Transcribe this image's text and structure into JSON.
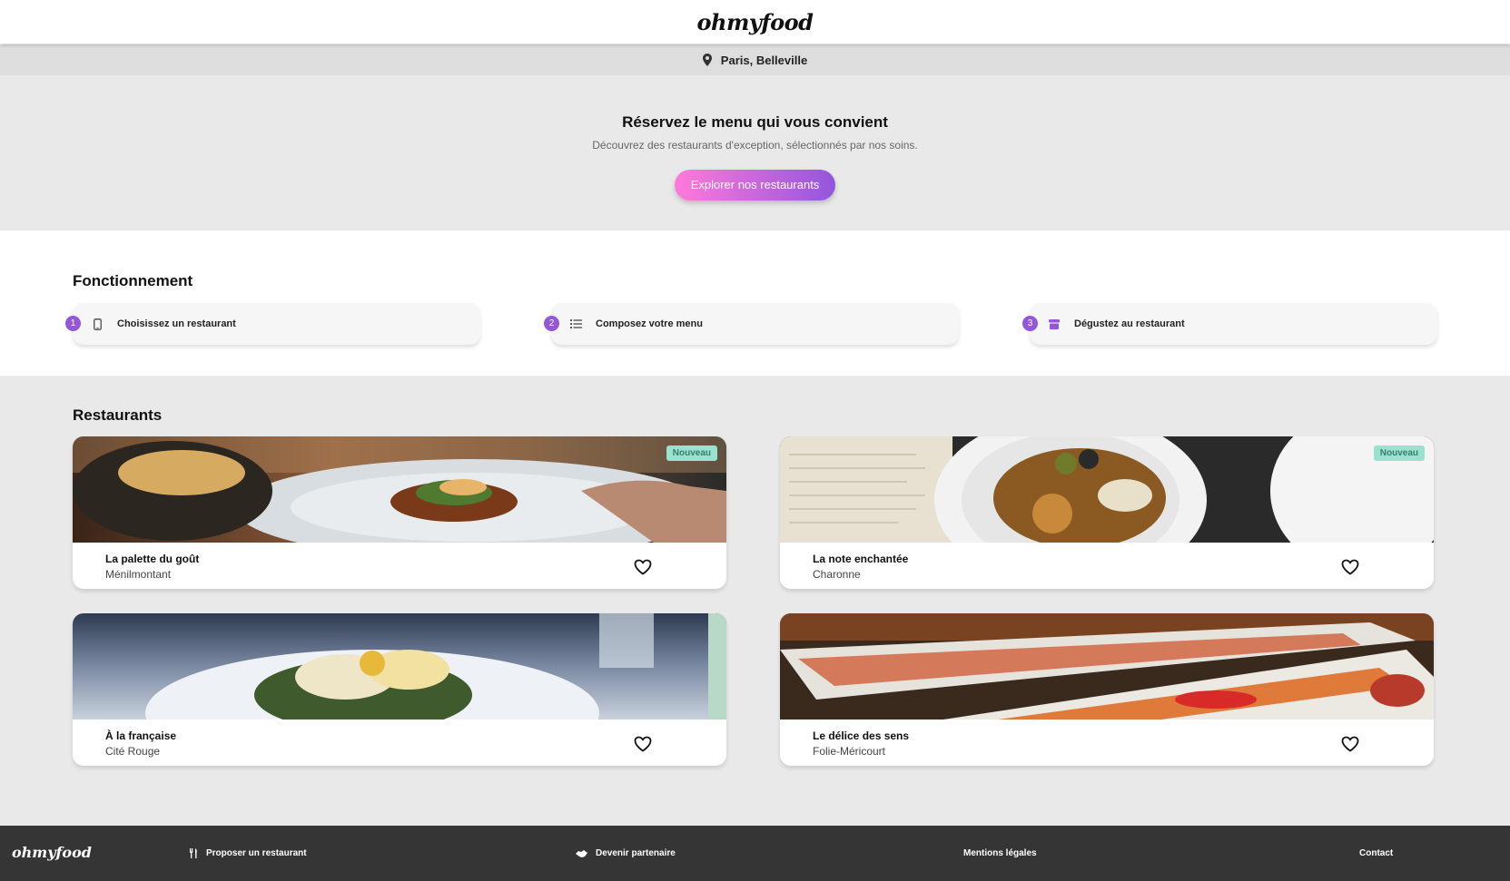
{
  "header": {
    "logo": "ohmyfood"
  },
  "location": {
    "icon": "map-pin-icon",
    "text": "Paris, Belleville"
  },
  "hero": {
    "title": "Réservez le menu qui vous convient",
    "subtitle": "Découvrez des restaurants d'exception, sélectionnés par nos soins.",
    "cta": "Explorer nos restaurants"
  },
  "how": {
    "title": "Fonctionnement",
    "steps": [
      {
        "number": "1",
        "icon": "mobile-phone-icon",
        "label": "Choisissez un restaurant"
      },
      {
        "number": "2",
        "icon": "list-icon",
        "label": "Composez votre menu"
      },
      {
        "number": "3",
        "icon": "store-icon",
        "label": "Dégustez au restaurant"
      }
    ]
  },
  "restaurants": {
    "title": "Restaurants",
    "items": [
      {
        "name": "La palette du goût",
        "area": "Ménilmontant",
        "badge": "Nouveau"
      },
      {
        "name": "La note enchantée",
        "area": "Charonne",
        "badge": "Nouveau"
      },
      {
        "name": "À la française",
        "area": "Cité Rouge",
        "badge": ""
      },
      {
        "name": "Le délice des sens",
        "area": "Folie-Méricourt",
        "badge": ""
      }
    ]
  },
  "footer": {
    "logo": "ohmyfood",
    "links": [
      {
        "icon": "utensils-icon",
        "label": "Proposer un restaurant"
      },
      {
        "icon": "handshake-icon",
        "label": "Devenir partenaire"
      },
      {
        "icon": "",
        "label": "Mentions légales"
      },
      {
        "icon": "",
        "label": "Contact"
      }
    ]
  },
  "colors": {
    "accent_purple": "#9356dc",
    "accent_pink": "#ff79da",
    "badge_bg": "#99e2d0",
    "footer_bg": "#353535"
  }
}
